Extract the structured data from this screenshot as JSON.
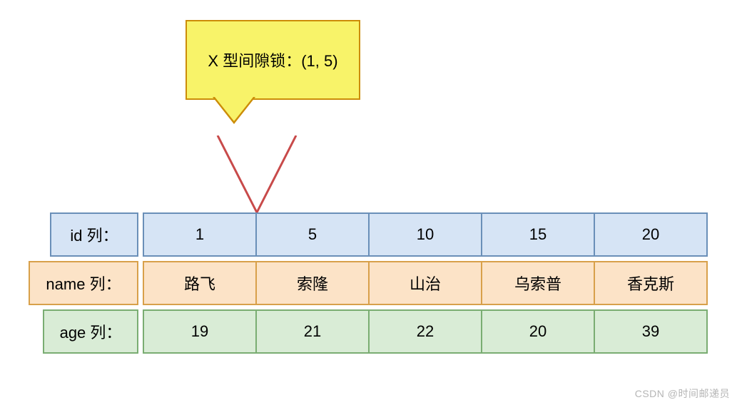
{
  "callout": {
    "text": "X 型间隙锁：(1, 5)"
  },
  "rows": {
    "id": {
      "label": "id 列：",
      "cells": [
        "1",
        "5",
        "10",
        "15",
        "20"
      ]
    },
    "name": {
      "label": "name 列：",
      "cells": [
        "路飞",
        "索隆",
        "山治",
        "乌索普",
        "香克斯"
      ]
    },
    "age": {
      "label": "age 列：",
      "cells": [
        "19",
        "21",
        "22",
        "20",
        "39"
      ]
    }
  },
  "watermark": "CSDN @时间邮递员"
}
